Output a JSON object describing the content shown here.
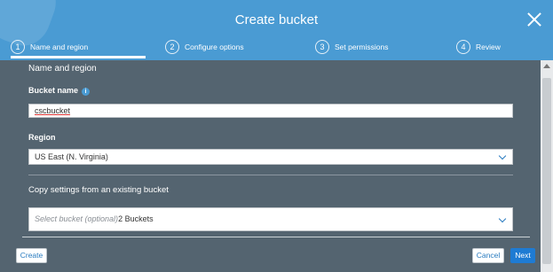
{
  "dialog": {
    "title": "Create bucket"
  },
  "steps": [
    {
      "number": "1",
      "label": "Name and region",
      "active": true
    },
    {
      "number": "2",
      "label": "Configure options",
      "active": false
    },
    {
      "number": "3",
      "label": "Set permissions",
      "active": false
    },
    {
      "number": "4",
      "label": "Review",
      "active": false
    }
  ],
  "section": {
    "title": "Name and region"
  },
  "bucket_name": {
    "label": "Bucket name",
    "info_icon": "i",
    "value": "cscbucket"
  },
  "region": {
    "label": "Region",
    "selected": "US East (N. Virginia)"
  },
  "copy_settings": {
    "title": "Copy settings from an existing bucket",
    "placeholder": "Select bucket (optional)",
    "count_text": "2 Buckets"
  },
  "footer": {
    "create_label": "Create",
    "cancel_label": "Cancel",
    "next_label": "Next"
  },
  "colors": {
    "header": "#4a9bd3",
    "body": "#546470",
    "primary_button": "#1e7bd3"
  }
}
